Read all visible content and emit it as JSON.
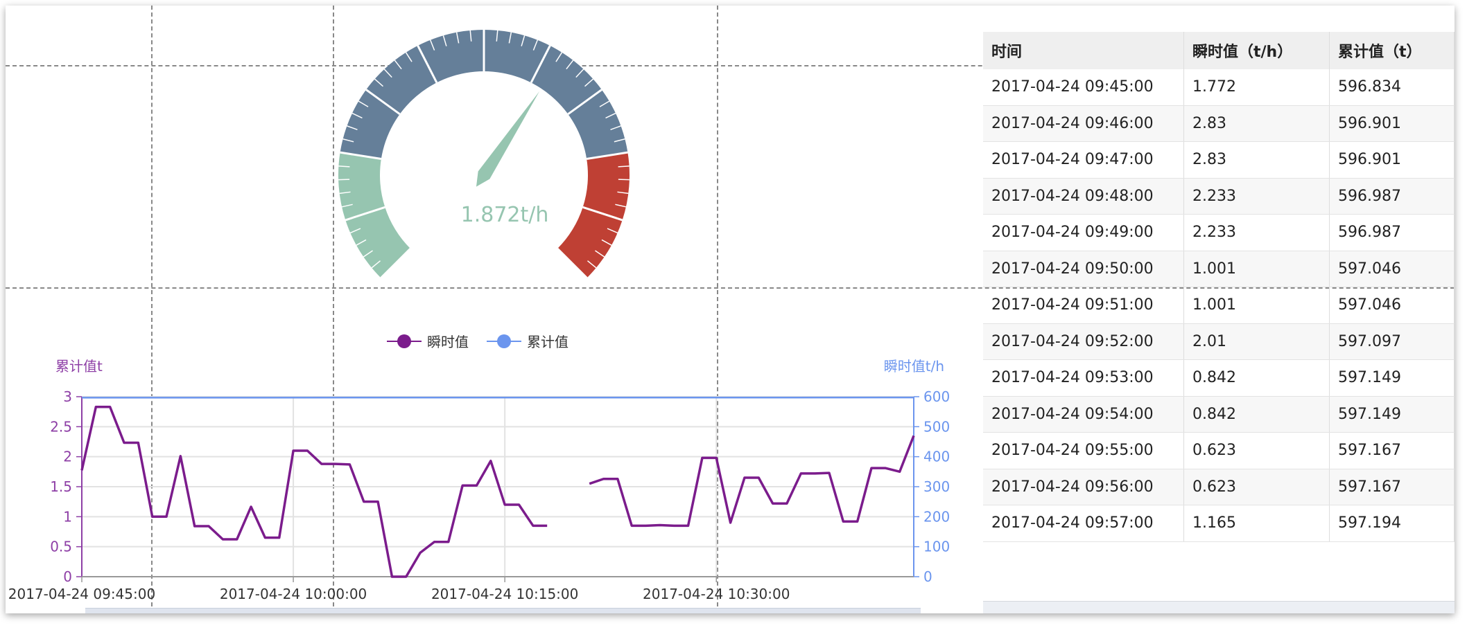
{
  "gauge": {
    "value_label": "1.872t/h",
    "value": 1.872,
    "min": 0,
    "max": 3,
    "bands": [
      {
        "to": 0.2,
        "color": "#96c5b0"
      },
      {
        "to": 0.8,
        "color": "#657f99"
      },
      {
        "to": 1.0,
        "color": "#bf4034"
      }
    ]
  },
  "chart_data": {
    "type": "line",
    "legend": [
      "瞬时值",
      "累计值"
    ],
    "left_axis_title": "累计值t",
    "right_axis_title": "瞬时值t/h",
    "left_ticks": [
      "0",
      "0.5",
      "1",
      "1.5",
      "2",
      "2.5",
      "3"
    ],
    "right_ticks": [
      "0",
      "100",
      "200",
      "300",
      "400",
      "500",
      "600"
    ],
    "x_ticks": [
      "2017-04-24 09:45:00",
      "2017-04-24 10:00:00",
      "2017-04-24 10:15:00",
      "2017-04-24 10:30:00"
    ],
    "ylim_left": [
      0,
      3
    ],
    "ylim_right": [
      0,
      600
    ],
    "x_range_minutes": [
      0,
      59
    ],
    "colors": {
      "series1": "#7b1c8c",
      "series2": "#6b95ee",
      "left_axis": "#8e3fa6",
      "right_axis": "#6b95ee"
    },
    "series": [
      {
        "name": "瞬时值",
        "color": "#7b1c8c",
        "axis": "left",
        "segments": [
          [
            [
              0,
              1.772
            ],
            [
              1,
              2.83
            ],
            [
              2,
              2.83
            ],
            [
              3,
              2.233
            ],
            [
              4,
              2.233
            ],
            [
              5,
              1.001
            ],
            [
              6,
              1.001
            ],
            [
              7,
              2.01
            ],
            [
              8,
              0.842
            ],
            [
              9,
              0.842
            ],
            [
              10,
              0.623
            ],
            [
              11,
              0.623
            ],
            [
              12,
              1.165
            ],
            [
              13,
              0.65
            ],
            [
              14,
              0.65
            ],
            [
              15,
              2.1
            ],
            [
              16,
              2.1
            ],
            [
              17,
              1.88
            ],
            [
              18,
              1.88
            ],
            [
              19,
              1.87
            ],
            [
              20,
              1.25
            ],
            [
              21,
              1.25
            ],
            [
              22,
              0.0
            ],
            [
              23,
              0.0
            ],
            [
              24,
              0.4
            ],
            [
              25,
              0.58
            ],
            [
              26,
              0.58
            ],
            [
              27,
              1.52
            ],
            [
              28,
              1.52
            ],
            [
              29,
              1.93
            ],
            [
              30,
              1.2
            ],
            [
              31,
              1.2
            ],
            [
              32,
              0.85
            ],
            [
              33,
              0.85
            ]
          ],
          [
            [
              36,
              1.55
            ],
            [
              37,
              1.63
            ],
            [
              38,
              1.63
            ],
            [
              39,
              0.85
            ],
            [
              40,
              0.85
            ],
            [
              41,
              0.86
            ],
            [
              42,
              0.85
            ],
            [
              43,
              0.85
            ],
            [
              44,
              1.98
            ],
            [
              45,
              1.98
            ],
            [
              46,
              0.9
            ],
            [
              47,
              1.65
            ],
            [
              48,
              1.65
            ],
            [
              49,
              1.22
            ],
            [
              50,
              1.22
            ],
            [
              51,
              1.72
            ],
            [
              52,
              1.72
            ],
            [
              53,
              1.73
            ],
            [
              54,
              0.92
            ],
            [
              55,
              0.92
            ],
            [
              56,
              1.81
            ],
            [
              57,
              1.81
            ],
            [
              58,
              1.75
            ],
            [
              59,
              2.35
            ]
          ]
        ]
      },
      {
        "name": "累计值",
        "color": "#6b95ee",
        "axis": "right",
        "segments": [
          [
            [
              0,
              596.834
            ],
            [
              59,
              597.3
            ]
          ]
        ]
      }
    ]
  },
  "table": {
    "headers": [
      "时间",
      "瞬时值（t/h）",
      "累计值（t）"
    ],
    "rows": [
      [
        "2017-04-24 09:45:00",
        "1.772",
        "596.834"
      ],
      [
        "2017-04-24 09:46:00",
        "2.83",
        "596.901"
      ],
      [
        "2017-04-24 09:47:00",
        "2.83",
        "596.901"
      ],
      [
        "2017-04-24 09:48:00",
        "2.233",
        "596.987"
      ],
      [
        "2017-04-24 09:49:00",
        "2.233",
        "596.987"
      ],
      [
        "2017-04-24 09:50:00",
        "1.001",
        "597.046"
      ],
      [
        "2017-04-24 09:51:00",
        "1.001",
        "597.046"
      ],
      [
        "2017-04-24 09:52:00",
        "2.01",
        "597.097"
      ],
      [
        "2017-04-24 09:53:00",
        "0.842",
        "597.149"
      ],
      [
        "2017-04-24 09:54:00",
        "0.842",
        "597.149"
      ],
      [
        "2017-04-24 09:55:00",
        "0.623",
        "597.167"
      ],
      [
        "2017-04-24 09:56:00",
        "0.623",
        "597.167"
      ],
      [
        "2017-04-24 09:57:00",
        "1.165",
        "597.194"
      ]
    ]
  }
}
